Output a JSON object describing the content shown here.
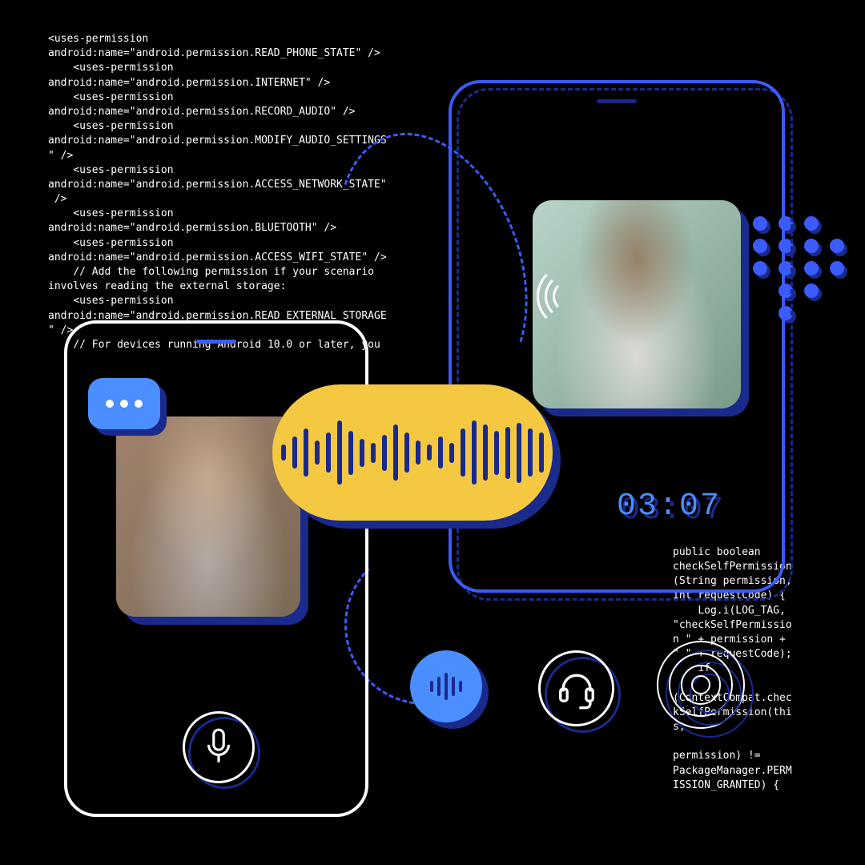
{
  "code_top": "<uses-permission\nandroid:name=\"android.permission.READ_PHONE_STATE\" />\n    <uses-permission\nandroid:name=\"android.permission.INTERNET\" />\n    <uses-permission\nandroid:name=\"android.permission.RECORD_AUDIO\" />\n    <uses-permission\nandroid:name=\"android.permission.MODIFY_AUDIO_SETTINGS\n\" />\n    <uses-permission\nandroid:name=\"android.permission.ACCESS_NETWORK_STATE\"\n />\n    <uses-permission\nandroid:name=\"android.permission.BLUETOOTH\" />\n    <uses-permission\nandroid:name=\"android.permission.ACCESS_WIFI_STATE\" />\n    // Add the following permission if your scenario\ninvolves reading the external storage:\n    <uses-permission\nandroid:name=\"android.permission.READ_EXTERNAL_STORAGE\n\" />\n    // For devices running Android 10.0 or later, you",
  "code_bottom": "public boolean\ncheckSelfPermission\n(String permission,\nint requestCode) {\n    Log.i(LOG_TAG,\n\"checkSelfPermissio\nn \" + permission +\n\" \" + requestCode);\n    if\n\n(ContextCompat.chec\nkSelfPermission(thi\ns,\n\npermission) !=\nPackageManager.PERM\nISSION_GRANTED) {",
  "timer": "03:07",
  "waveform_heights": [
    20,
    40,
    60,
    30,
    50,
    80,
    55,
    35,
    25,
    45,
    70,
    50,
    30,
    20,
    40,
    25,
    60,
    80,
    70,
    55,
    65,
    75,
    60,
    50
  ],
  "mini_wave_heights": [
    14,
    24,
    34,
    24,
    14
  ],
  "colors": {
    "accent_blue": "#4b8eff",
    "dark_blue": "#1a2a8c",
    "bright_blue": "#3b5bff",
    "yellow": "#f5c842",
    "white": "#ffffff"
  }
}
